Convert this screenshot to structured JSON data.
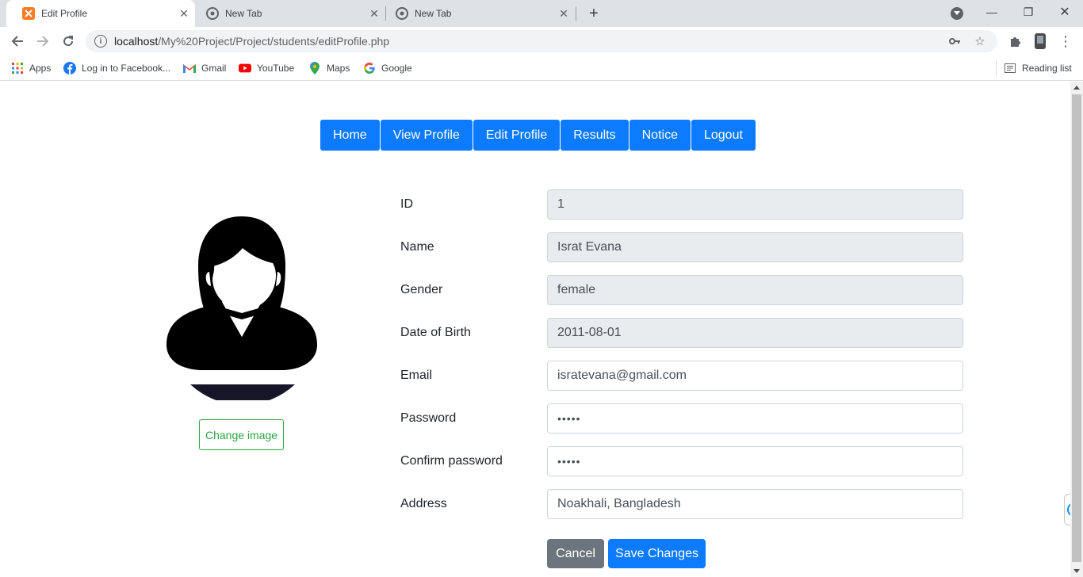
{
  "browser": {
    "tabs": [
      {
        "title": "Edit Profile",
        "icon": "xampp-icon",
        "active": true
      },
      {
        "title": "New Tab",
        "icon": "chrome-icon",
        "active": false
      },
      {
        "title": "New Tab",
        "icon": "chrome-icon",
        "active": false
      }
    ],
    "url_host": "localhost",
    "url_path": "/My%20Project/Project/students/editProfile.php",
    "bookmarks": [
      {
        "label": "Apps",
        "icon": "apps-grid-icon"
      },
      {
        "label": "Log in to Facebook...",
        "icon": "facebook-icon"
      },
      {
        "label": "Gmail",
        "icon": "gmail-icon"
      },
      {
        "label": "YouTube",
        "icon": "youtube-icon"
      },
      {
        "label": "Maps",
        "icon": "maps-pin-icon"
      },
      {
        "label": "Google",
        "icon": "google-icon"
      }
    ],
    "reading_list": "Reading list"
  },
  "nav": {
    "items": [
      "Home",
      "View Profile",
      "Edit Profile",
      "Results",
      "Notice",
      "Logout"
    ]
  },
  "profile": {
    "change_image": "Change image"
  },
  "form": {
    "fields": [
      {
        "label": "ID",
        "value": "1",
        "readonly": true
      },
      {
        "label": "Name",
        "value": "Israt Evana",
        "readonly": true
      },
      {
        "label": "Gender",
        "value": "female",
        "readonly": true
      },
      {
        "label": "Date of Birth",
        "value": "2011-08-01",
        "readonly": true
      },
      {
        "label": "Email",
        "value": "isratevana@gmail.com",
        "readonly": false
      },
      {
        "label": "Password",
        "value": "•••••",
        "readonly": false
      },
      {
        "label": "Confirm password",
        "value": "•••••",
        "readonly": false
      },
      {
        "label": "Address",
        "value": "Noakhali, Bangladesh",
        "readonly": false
      }
    ],
    "cancel": "Cancel",
    "save": "Save Changes"
  },
  "colors": {
    "primary": "#0d7bff",
    "secondary": "#6c757d",
    "success": "#28a745",
    "readonly_bg": "#e9ecef"
  }
}
